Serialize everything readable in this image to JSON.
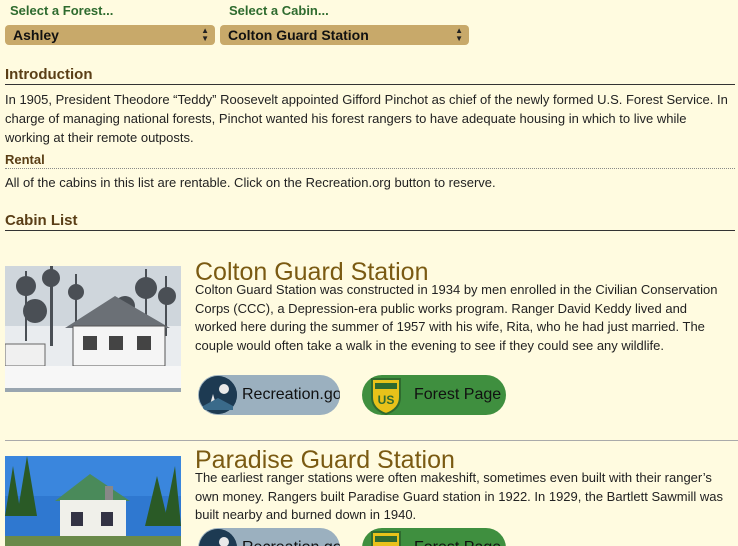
{
  "selectors": {
    "forest_label": "Select a Forest...",
    "forest_value": "Ashley",
    "cabin_label": "Select a Cabin...",
    "cabin_value": "Colton Guard Station"
  },
  "intro": {
    "heading": "Introduction",
    "text": "In 1905, President Theodore “Teddy” Roosevelt appointed Gifford Pinchot as chief of the newly formed U.S. Forest Service. In charge of managing national forests, Pinchot wanted his forest rangers to have adequate housing in which to live while working at their remote outposts."
  },
  "rental": {
    "heading": "Rental",
    "text": "All of the cabins in this list are rentable. Click on the Recreation.org button to reserve."
  },
  "cabin_list": {
    "heading": "Cabin List",
    "cabins": [
      {
        "title": "Colton Guard Station",
        "description": "Colton Guard Station was constructed in 1934 by men enrolled in the Civilian Conservation Corps (CCC), a Depression-era public works program. Ranger David Keddy lived and worked here during the summer of 1957 with his wife, Rita, who he had just married. The couple would often take a walk in the evening to see if they could see any wildlife.",
        "recreation_label": "Recreation.gov",
        "forest_label": "Forest Page"
      },
      {
        "title": "Paradise Guard Station",
        "description": "The earliest ranger stations were often makeshift, sometimes even built with their ranger’s own money. Rangers built Paradise Guard station in 1922. In 1929, the Bartlett Sawmill was built nearby and burned down in 1940.",
        "recreation_label": "Recreation.gov",
        "forest_label": "Forest Page"
      }
    ]
  },
  "icons": {
    "select_arrows": "up-down-chevron-icon",
    "recreation_logo": "recreation-gov-logo-icon",
    "forest_logo": "us-forest-service-shield-icon"
  },
  "colors": {
    "background": "#fffbe0",
    "select_bg": "#c8a96a",
    "heading": "#5a3e16",
    "cabin_title": "#7a5a12",
    "selector_label": "#2e6b2e",
    "recreation_button": "#9bb0bf",
    "forest_button": "#3f8f3f"
  }
}
